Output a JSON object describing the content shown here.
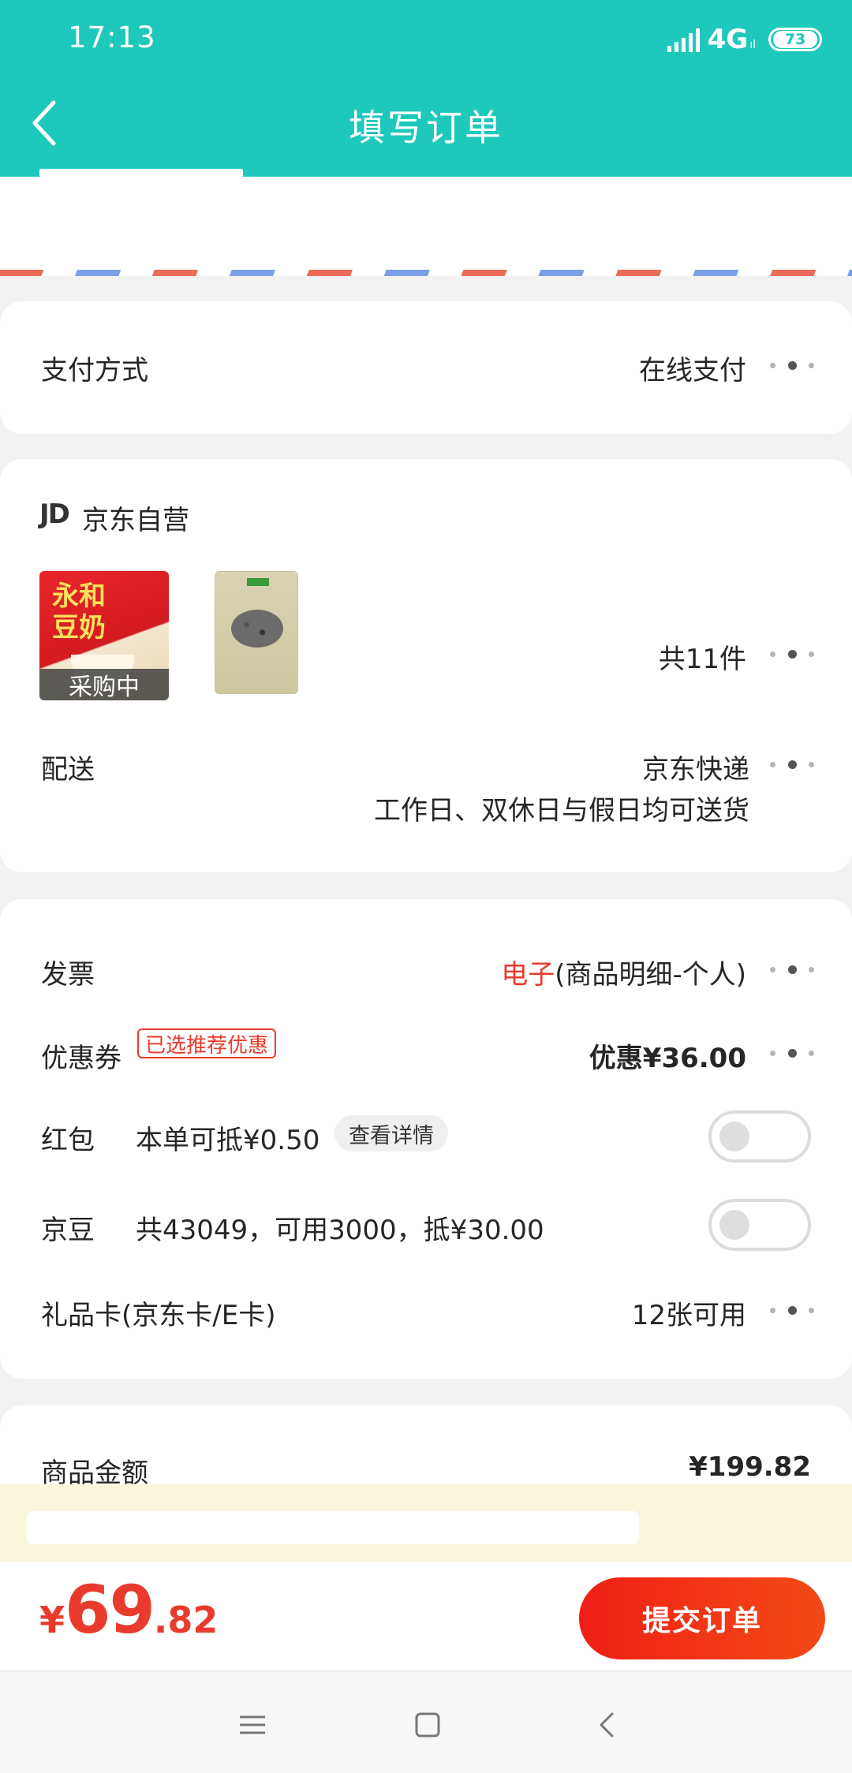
{
  "status_bar": {
    "time": "17:13",
    "network": "4G",
    "network_sub": "ıl",
    "battery": "73"
  },
  "header": {
    "title": "填写订单"
  },
  "payment": {
    "label": "支付方式",
    "value": "在线支付"
  },
  "store": {
    "logo": "JD",
    "name": "京东自营",
    "purchase_badge": "采购中",
    "item_count": "共11件",
    "delivery_label": "配送",
    "delivery_value": "京东快递",
    "delivery_note": "工作日、双休日与假日均可送货"
  },
  "extras": {
    "invoice_label": "发票",
    "invoice_type": "电子",
    "invoice_detail": "(商品明细-个人)",
    "coupon_label": "优惠券",
    "coupon_tag": "已选推荐优惠",
    "coupon_value": "优惠¥36.00",
    "redpacket_label": "红包",
    "redpacket_text": "本单可抵¥0.50",
    "redpacket_link": "查看详情",
    "jingdou_label": "京豆",
    "jingdou_text": "共43049，可用3000，抵¥30.00",
    "giftcard_label": "礼品卡(京东卡/E卡)",
    "giftcard_value": "12张可用"
  },
  "summary": {
    "goods_amount_label": "商品金额",
    "goods_amount_value": "¥199.82"
  },
  "bottom": {
    "currency": "¥",
    "total_int": "69",
    "total_dec": ".82",
    "submit_label": "提交订单"
  },
  "colors": {
    "header": "#1ec8bc",
    "accent_red": "#e93b2d",
    "submit_gradient_start": "#f01f16"
  },
  "icons": [
    "back-arrow-icon",
    "more-dots-icon",
    "menu-icon",
    "home-square-icon",
    "nav-back-icon"
  ]
}
